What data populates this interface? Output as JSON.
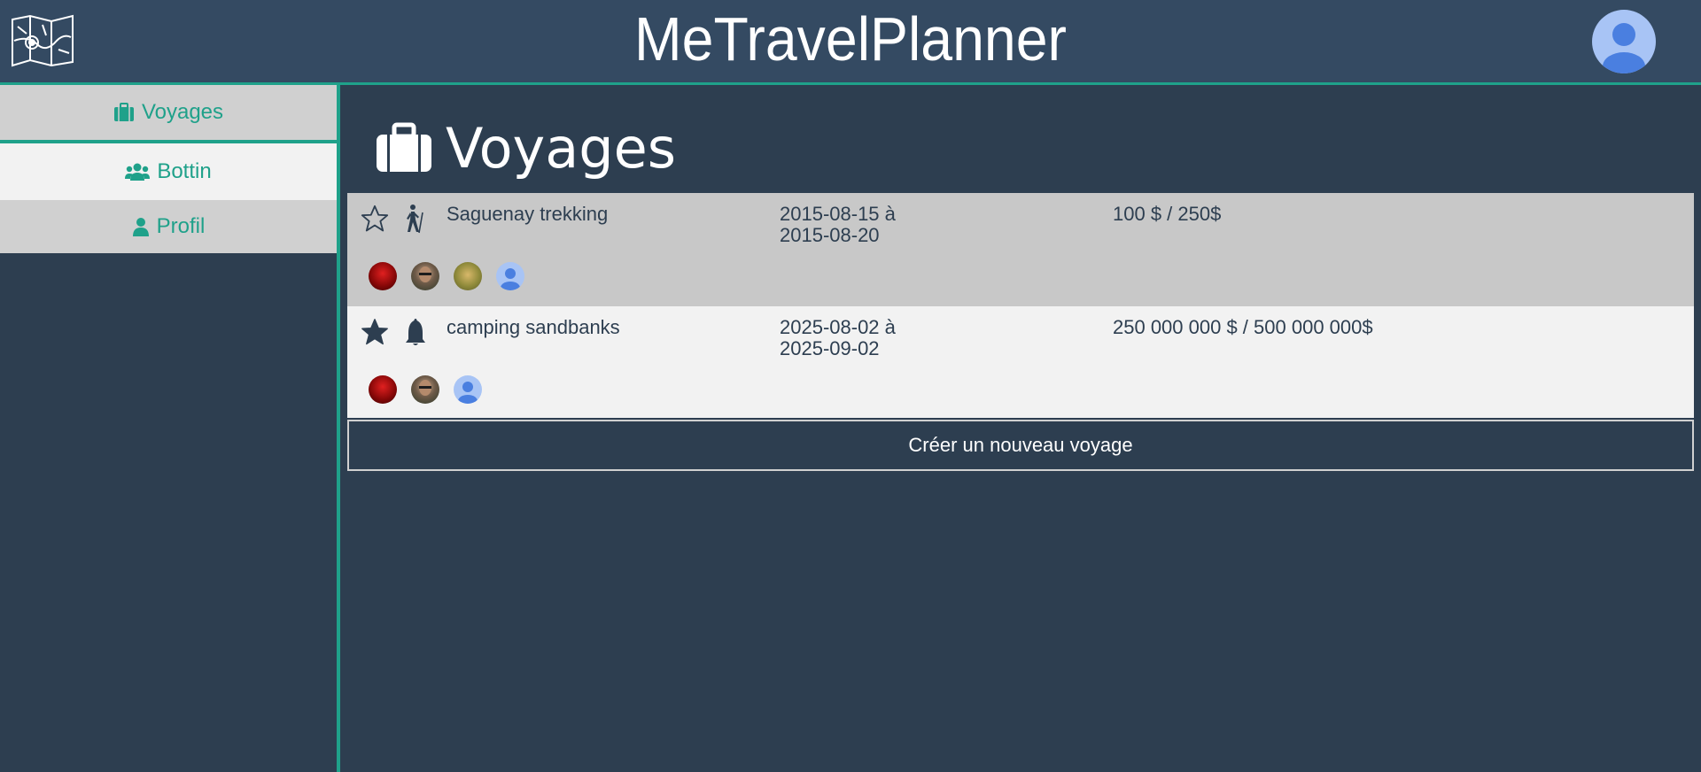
{
  "header": {
    "app_title": "MeTravelPlanner",
    "logo_icon": "folded-map-icon",
    "user_icon": "user-avatar-icon"
  },
  "sidebar": {
    "items": [
      {
        "label": "Voyages",
        "icon": "suitcase-icon",
        "active": true
      },
      {
        "label": "Bottin",
        "icon": "users-icon",
        "active": false
      },
      {
        "label": "Profil",
        "icon": "user-icon",
        "active": false
      }
    ]
  },
  "main": {
    "title": "Voyages",
    "title_icon": "suitcase-icon",
    "trips": [
      {
        "name": "Saguenay trekking",
        "date_start": "2015-08-15 à",
        "date_end": "2015-08-20",
        "budget": "100 $ / 250$",
        "favorite": false,
        "activity_icon": "hiking-icon",
        "members": [
          "member-red",
          "member-face",
          "member-nature",
          "member-default"
        ]
      },
      {
        "name": "camping sandbanks",
        "date_start": "2025-08-02 à",
        "date_end": "2025-09-02",
        "budget": "250 000 000 $ / 500 000 000$",
        "favorite": true,
        "activity_icon": "bell-icon",
        "members": [
          "member-red",
          "member-face",
          "member-default"
        ]
      }
    ],
    "create_button": "Créer un nouveau voyage"
  },
  "colors": {
    "background": "#2d3e50",
    "header": "#344a62",
    "accent": "#1fa18a",
    "row_gray": "#c8c8c8",
    "row_light": "#f2f2f2"
  }
}
